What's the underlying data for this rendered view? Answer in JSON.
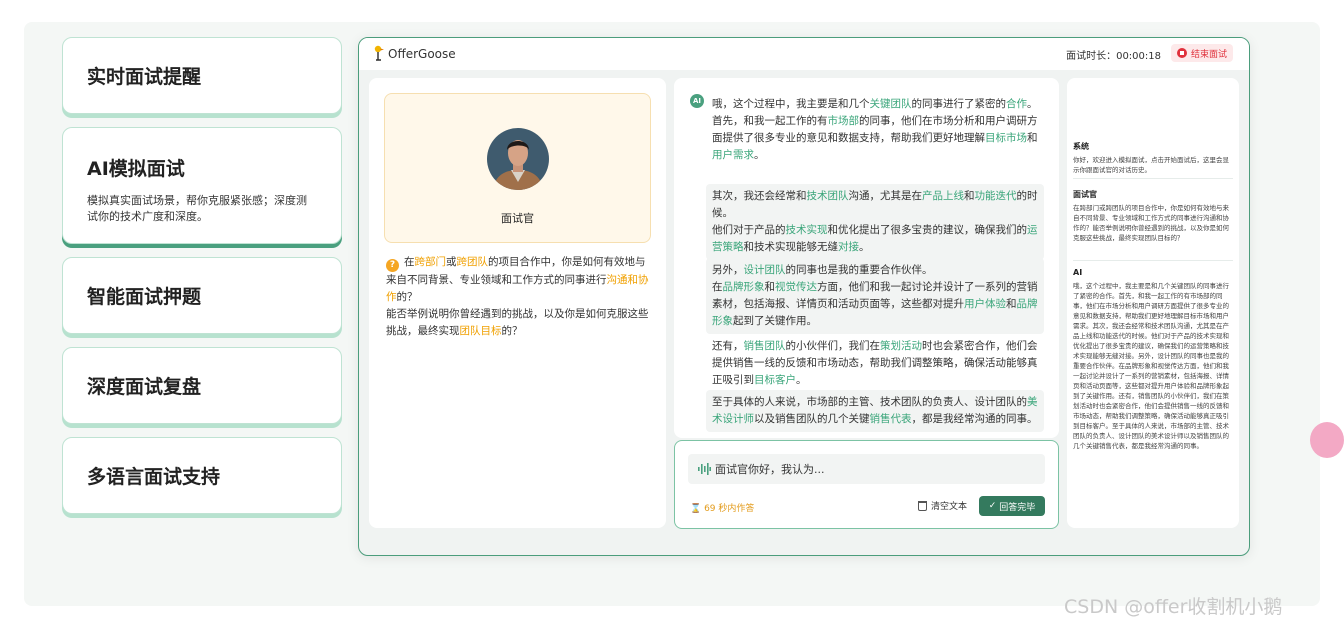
{
  "features": [
    {
      "title": "实时面试提醒",
      "desc": ""
    },
    {
      "title": "AI模拟面试",
      "desc": "模拟真实面试场景，帮你克服紧张感；深度测试你的技术广度和深度。"
    },
    {
      "title": "智能面试押题",
      "desc": ""
    },
    {
      "title": "深度面试复盘",
      "desc": ""
    },
    {
      "title": "多语言面试支持",
      "desc": ""
    }
  ],
  "app": {
    "logo_text": "OfferGoose",
    "timer_label": "面试时长：00:00:18",
    "end_button": "结束面试"
  },
  "interviewer": {
    "label": "面试官",
    "question": {
      "p1": "在",
      "k1": "跨部门",
      "p2": "或",
      "k2": "跨团队",
      "p3": "的项目合作中，你是如何有效地与来自不同背景、专业领域和工作方式的同事进行",
      "k3": "沟通和协作",
      "p4": "的？",
      "p5": "能否举例说明你曾经遇到的挑战，以及你是如何克服这些挑战，最终实现",
      "k4": "团队目标",
      "p6": "的？"
    }
  },
  "answer": {
    "ai_badge": "AI",
    "b1": {
      "a": "哦，这个过程中，我主要是和几个",
      "b": "关键团队",
      "c": "的同事进行了紧密的",
      "d": "合作",
      "e": "。"
    },
    "b2": {
      "a": "首先，和我一起工作的有",
      "b": "市场部",
      "c": "的同事，他们在市场分析和用户调研方面提供了很多专业的意见和数据支持，帮助我们更好地理解",
      "d": "目标市场",
      "e": "和",
      "f": "用户需求",
      "g": "。"
    },
    "b3": {
      "a": "其次，我还会经常和",
      "b": "技术团队",
      "c": "沟通，尤其是在",
      "d": "产品上线",
      "e": "和",
      "f": "功能迭代",
      "g": "的时候。"
    },
    "b4": {
      "a": "他们对于产品的",
      "b": "技术实现",
      "c": "和优化提出了很多宝贵的建议，确保我们的",
      "d": "运营策略",
      "e": "和技术实现能够无缝",
      "f": "对接",
      "g": "。"
    },
    "b5": {
      "a": "另外，",
      "b": "设计团队",
      "c": "的同事也是我的重要合作伙伴。"
    },
    "b6": {
      "a": "在",
      "b": "品牌形象",
      "c": "和",
      "d": "视觉传达",
      "e": "方面，他们和我一起讨论并设计了一系列的营销素材，包括海报、详情页和活动页面等，这些都对提升",
      "f": "用户体验",
      "g": "和",
      "h": "品牌形象",
      "i": "起到了关键作用。"
    },
    "b7": {
      "a": "还有，",
      "b": "销售团队",
      "c": "的小伙伴们，我们在",
      "d": "策划活动",
      "e": "时也会紧密合作，他们会提供销售一线的反馈和市场动态，帮助我们调整策略，确保活动能够真正吸引到",
      "f": "目标客户",
      "g": "。"
    },
    "b8": {
      "a": "至于具体的人来说，市场部的主管、技术团队的负责人、设计团队的",
      "b": "美术设计师",
      "c": "以及销售团队的几个关键",
      "d": "销售代表",
      "e": "，都是我经常沟通的同事。"
    }
  },
  "input": {
    "value": "面试官你好，我认为...",
    "countdown": "69 秒内作答",
    "clear_label": "清空文本",
    "done_label": "回答完毕"
  },
  "history": {
    "system_title": "系统",
    "system_text": "你好，欢迎进入模拟面试，点击开始面试后，这里会显示你跟面试官的对话历史。",
    "interviewer_title": "面试官",
    "interviewer_text": "在跨部门或跨团队的项目合作中，你是如何有效地与来自不同背景、专业领域和工作方式的同事进行沟通和协作的？能否举例说明你曾经遇到的挑战，以及你是如何克服这些挑战，最终实现团队目标的？",
    "ai_title": "AI",
    "ai_text": "哦，这个过程中，我主要是和几个关键团队的同事进行了紧密的合作。首先，和我一起工作的有市场部的同事，他们在市场分析和用户调研方面提供了很多专业的意见和数据支持，帮助我们更好地理解目标市场和用户需求。其次，我还会经常和技术团队沟通，尤其是在产品上线和功能迭代的时候。他们对于产品的技术实现和优化提出了很多宝贵的建议，确保我们的运营策略和技术实现能够无缝对接。另外，设计团队的同事也是我的重要合作伙伴。在品牌形象和视觉传达方面，他们和我一起讨论并设计了一系列的营销素材，包括海报、详情页和活动页面等，这些都对提升用户体验和品牌形象起到了关键作用。还有，销售团队的小伙伴们，我们在策划活动时也会紧密合作，他们会提供销售一线的反馈和市场动态，帮助我们调整策略，确保活动能够真正吸引到目标客户。至于具体的人来说，市场部的主管、技术团队的负责人、设计团队的美术设计师以及销售团队的几个关键销售代表，都是我经常沟通的同事。"
  },
  "watermark": "CSDN @offer收割机小鹅",
  "colors": {
    "accent": "#4aa07f",
    "highlight_orange": "#f0a000",
    "highlight_green": "#3aa57a",
    "end_red": "#e0313c"
  }
}
